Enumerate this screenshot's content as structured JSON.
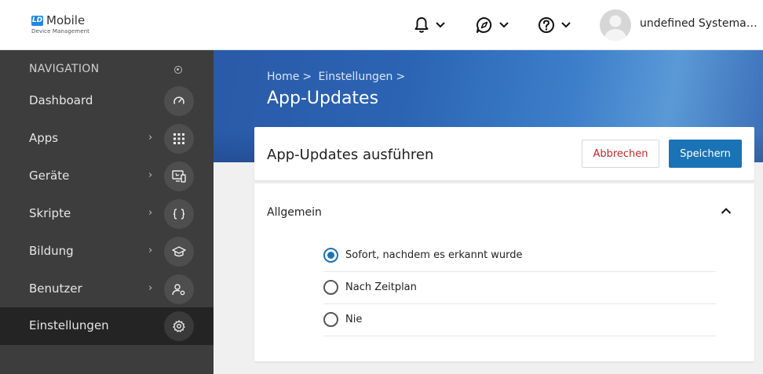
{
  "header": {
    "logo_badge": "LD",
    "logo_title": "Mobile",
    "logo_subtitle": "Device Management",
    "username": "undefined Systemadministrator"
  },
  "sidebar": {
    "header": "NAVIGATION",
    "items": [
      {
        "label": "Dashboard",
        "icon": "gauge-icon",
        "has_children": false
      },
      {
        "label": "Apps",
        "icon": "grid-icon",
        "has_children": true
      },
      {
        "label": "Geräte",
        "icon": "devices-icon",
        "has_children": true
      },
      {
        "label": "Skripte",
        "icon": "braces-icon",
        "has_children": true
      },
      {
        "label": "Bildung",
        "icon": "graduation-cap-icon",
        "has_children": true
      },
      {
        "label": "Benutzer",
        "icon": "user-settings-icon",
        "has_children": true
      },
      {
        "label": "Einstellungen",
        "icon": "gear-icon",
        "has_children": false,
        "active": true
      }
    ]
  },
  "breadcrumb": {
    "items": [
      "Home",
      "Einstellungen"
    ],
    "separator": ">"
  },
  "page": {
    "title": "App-Updates"
  },
  "card": {
    "title": "App-Updates ausführen",
    "cancel_label": "Abbrechen",
    "save_label": "Speichern",
    "section_label": "Allgemein",
    "options": [
      {
        "label": "Sofort, nachdem es erkannt wurde",
        "selected": true
      },
      {
        "label": "Nach Zeitplan",
        "selected": false
      },
      {
        "label": "Nie",
        "selected": false
      }
    ]
  },
  "colors": {
    "accent": "#1a73b5",
    "cancel_text": "#c62828",
    "sidebar_bg": "#3d3d3d",
    "sidebar_active_bg": "#242424"
  }
}
